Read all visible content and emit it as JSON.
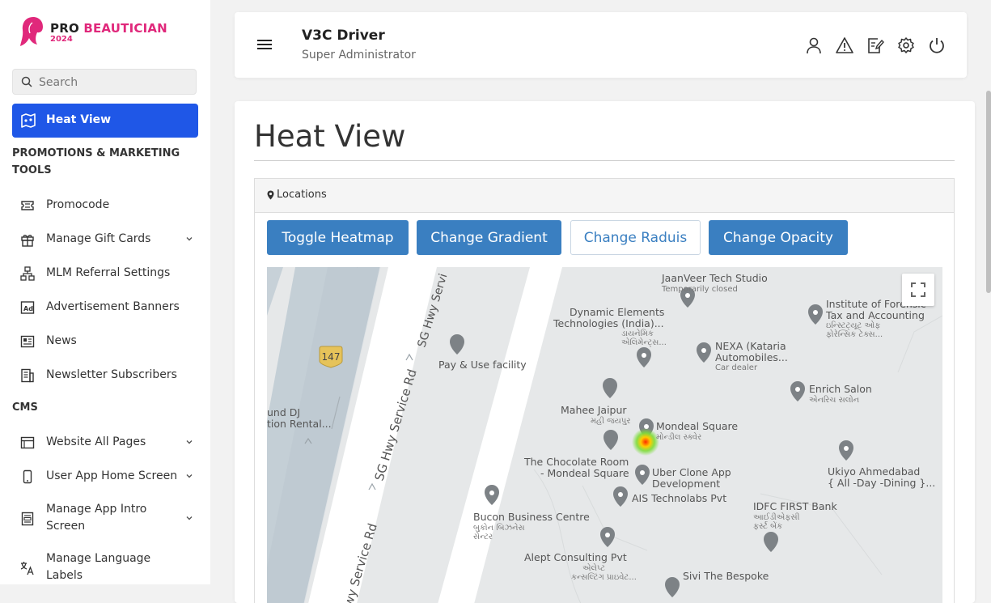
{
  "logo": {
    "brand_pro": "PRO",
    "brand_beautician": "BEAUTICIAN",
    "year": "2024"
  },
  "sidebar": {
    "search_placeholder": "Search",
    "active_item": {
      "label": "Heat View",
      "icon": "heat-view-icon"
    },
    "section_promotions": "PROMOTIONS & MARKETING TOOLS",
    "promotions_items": [
      {
        "label": "Promocode",
        "icon": "ticket-icon",
        "has_chevron": false
      },
      {
        "label": "Manage Gift Cards",
        "icon": "gift-icon",
        "has_chevron": true
      },
      {
        "label": "MLM Referral Settings",
        "icon": "hierarchy-icon",
        "has_chevron": false
      },
      {
        "label": "Advertisement Banners",
        "icon": "ad-icon",
        "has_chevron": false
      },
      {
        "label": "News",
        "icon": "newspaper-icon",
        "has_chevron": false
      },
      {
        "label": "Newsletter Subscribers",
        "icon": "subscribers-icon",
        "has_chevron": false
      }
    ],
    "section_cms": "CMS",
    "cms_items": [
      {
        "label": "Website All Pages",
        "icon": "browser-icon",
        "has_chevron": true
      },
      {
        "label": "User App Home Screen",
        "icon": "mobile-icon",
        "has_chevron": true
      },
      {
        "label": "Manage App Intro Screen",
        "icon": "intro-screen-icon",
        "has_chevron": true
      },
      {
        "label": "Manage Language Labels",
        "icon": "language-icon",
        "has_chevron": false
      }
    ]
  },
  "header": {
    "user_name": "V3C Driver",
    "user_role": "Super Administrator",
    "icons": [
      "user-icon",
      "alert-icon",
      "edit-note-icon",
      "settings-icon",
      "power-icon"
    ]
  },
  "main": {
    "title": "Heat View",
    "panel_title": "Locations",
    "buttons": [
      {
        "label": "Toggle Heatmap",
        "style": "primary"
      },
      {
        "label": "Change Gradient",
        "style": "primary"
      },
      {
        "label": "Change Raduis",
        "style": "outline"
      },
      {
        "label": "Change Opacity",
        "style": "primary"
      }
    ]
  },
  "map": {
    "highway_shield": "147",
    "road_labels": [
      "SG Hwy Servi",
      "SG Hwy Service Rd",
      "SG Hwy Service Rd"
    ],
    "places": [
      {
        "name": "JaanVeer Tech Studio",
        "sub": "Temporarily closed"
      },
      {
        "name": "Dynamic Elements Technologies (India)...",
        "local": "ડાયનેમિક એલિમેન્ટ્સ..."
      },
      {
        "name": "Institute of Forensic Tax and Accounting",
        "local": "ઇન્સ્ટિટ્યૂટ ઓફ ફોરેન્સિક ટેક્સ..."
      },
      {
        "name": "Pay & Use facility"
      },
      {
        "name": "NEXA (Kataria Automobiles...",
        "sub": "Car dealer"
      },
      {
        "name": "Enrich Salon",
        "local": "એનરિચ સલોન"
      },
      {
        "name": "und DJ tion Rental..."
      },
      {
        "name": "Mahee Jaipur",
        "local": "મહી જયપુર"
      },
      {
        "name": "Mondeal Square",
        "local": "મોન્ડીલ સ્ક્વેર"
      },
      {
        "name": "The Chocolate Room - Mondeal Square"
      },
      {
        "name": "Uber Clone App Development"
      },
      {
        "name": "Ukiyo Ahmedabad { All -Day -Dining }..."
      },
      {
        "name": "AIS Technolabs Pvt"
      },
      {
        "name": "IDFC FIRST Bank",
        "local": "આઈડીએફસી ફર્સ્ટ બેંક"
      },
      {
        "name": "Bucon Business Centre",
        "local": "બુકોન બિઝનેસ સેન્ટર"
      },
      {
        "name": "Alept Consulting Pvt",
        "local": "એલેપ્ટ કન્સલ્ટિંગ પ્રાઇવેટ..."
      },
      {
        "name": "Sivi The Bespoke"
      }
    ],
    "fullscreen_icon": "fullscreen-icon"
  }
}
